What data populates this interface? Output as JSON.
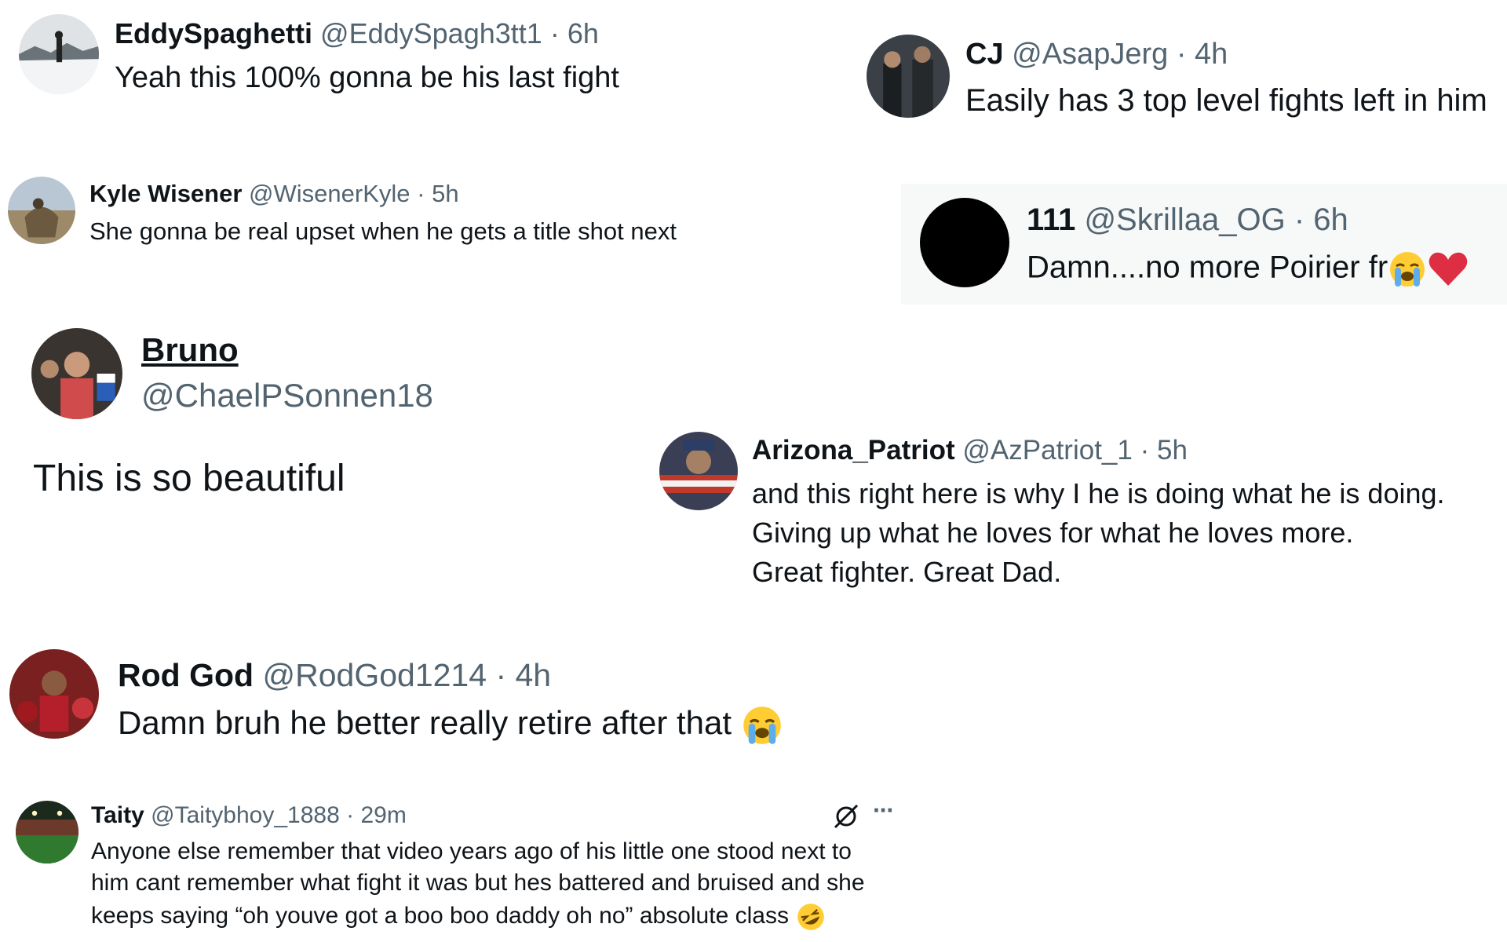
{
  "replies": [
    {
      "name": "EddySpaghetti",
      "handle": "@EddySpagh3tt1",
      "time": "6h",
      "text": "Yeah this 100% gonna be his last fight"
    },
    {
      "name": "CJ",
      "handle": "@AsapJerg",
      "time": "4h",
      "text": "Easily has 3 top level fights left in him"
    },
    {
      "name": "Kyle Wisener",
      "handle": "@WisenerKyle",
      "time": "5h",
      "text": "She gonna be real upset when he gets a title shot next"
    },
    {
      "name": "111",
      "handle": "@Skrillaa_OG",
      "time": "6h",
      "text": "Damn....no more Poirier fr"
    },
    {
      "name": "Bruno",
      "handle": "@ChaelPSonnen18",
      "text": "This is so beautiful"
    },
    {
      "name": "Arizona_Patriot",
      "handle": "@AzPatriot_1",
      "time": "5h",
      "lines": [
        "and this right here is why I he is doing what he is doing.",
        "Giving up what he loves for what he loves more.",
        "Great fighter. Great Dad."
      ]
    },
    {
      "name": "Rod God",
      "handle": "@RodGod1214",
      "time": "4h",
      "text": "Damn bruh he better really retire after that"
    },
    {
      "name": "Taity",
      "handle": "@Taitybhoy_1888",
      "time": "29m",
      "lines": [
        "Anyone else remember that video years ago of his little one stood next to",
        "him cant remember what fight it was but hes battered and bruised and she",
        "keeps saying “oh youve got a boo boo daddy oh no” absolute class"
      ]
    }
  ],
  "separator": "·",
  "icons": {
    "more": "···",
    "grok": "grok-icon",
    "crying": "loudly-crying-face-emoji",
    "heart": "red-heart-emoji",
    "laughing": "rolling-laughing-emoji"
  },
  "colors": {
    "name": "#0f1419",
    "meta": "#536471",
    "highlight_bg": "#f7f9f9"
  }
}
